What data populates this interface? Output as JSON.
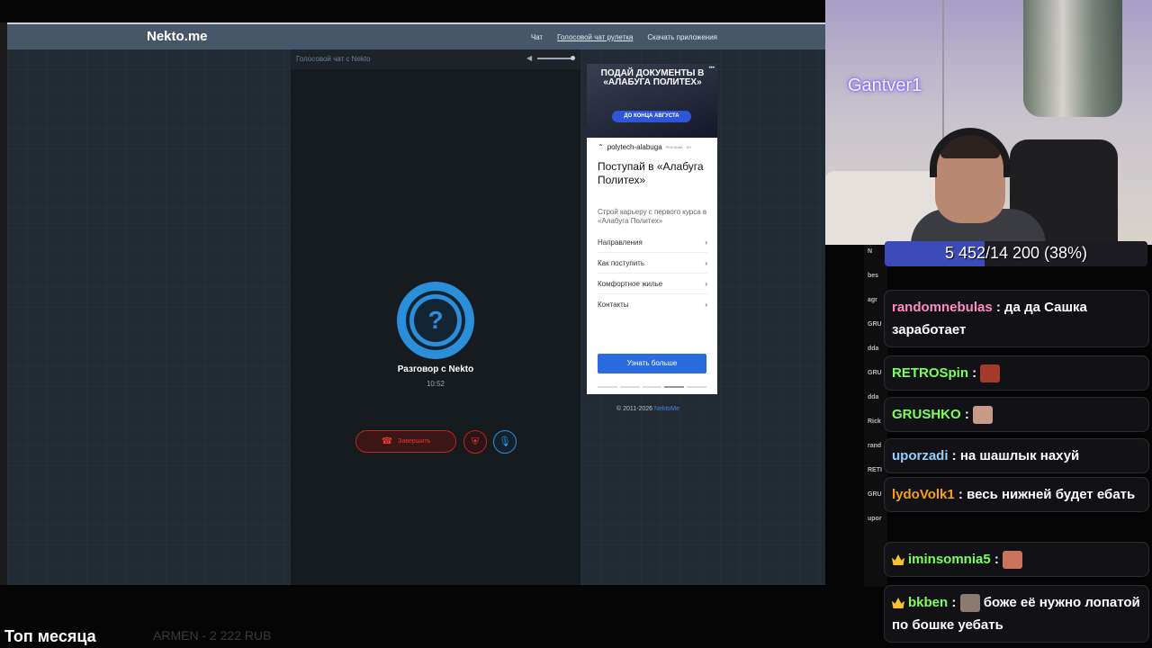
{
  "site": {
    "logo": "Nekto.me",
    "nav": [
      "Чат",
      "Голосовой чат рулетка",
      "Скачать приложения"
    ],
    "nav_active_index": 1
  },
  "voice_chat": {
    "panel_title": "Голосовой чат с Nekto",
    "avatar_symbol": "?",
    "conversation_title": "Разговор с Nekto",
    "timer": "10:52",
    "end_button_label": "Завершить",
    "volume_level": 1.0
  },
  "ad": {
    "banner_text": "ПОДАЙ ДОКУМЕНТЫ В «АЛАБУГА ПОЛИТЕХ»",
    "banner_pill": "ДО КОНЦА АВГУСТА",
    "source": "polytech-alabuga",
    "source_tag": "РЕКЛАМА · 16+",
    "headline": "Поступай в «Алабуга Политех»",
    "subtext": "Строй карьеру с первого курса в «Алабуга Политех»",
    "links": [
      "Направления",
      "Как поступить",
      "Комфортное жилье",
      "Контакты"
    ],
    "cta": "Узнать больше"
  },
  "footer": {
    "copyright": "© 2011-2026",
    "copyright_link": "NektoMe"
  },
  "stream": {
    "streamer_name": "Gantver1",
    "goal_text": "5 452/14 200 (38%)",
    "goal_fraction": 0.38,
    "top_month_label": "Топ месяца",
    "top_donor": "ARMEN - 2 222 RUB"
  },
  "chat_sidebar_rows": [
    "N",
    "bes",
    "agr",
    "GRU",
    "dda",
    "GRU",
    "dda",
    "Rick",
    "rand",
    "RETI",
    "GRU",
    "upor"
  ],
  "chat": [
    {
      "user": "randomnebulas",
      "color": "#ff8cc6",
      "text": "да да Сашка заработает"
    },
    {
      "user": "RETROSpin",
      "color": "#7cff5a",
      "text": ""
    },
    {
      "user": "GRUSHKO",
      "color": "#7cff5a",
      "text": ""
    },
    {
      "user": "uporzadi",
      "color": "#8fd0ff",
      "text": "на шашлык нахуй"
    },
    {
      "user": "lydoVolk1",
      "color": "#f6a01a",
      "text": "весь нижней будет ебать"
    },
    {
      "user": "iminsomnia5",
      "color": "#7cff5a",
      "text": ""
    },
    {
      "user": "bkben",
      "color": "#7cff5a",
      "text": "боже её нужно лопатой по бошке уебать"
    }
  ],
  "colors": {
    "nekto_blue": "#2a8fd8",
    "end_red": "#e43a31",
    "topbar": "#46576a"
  }
}
